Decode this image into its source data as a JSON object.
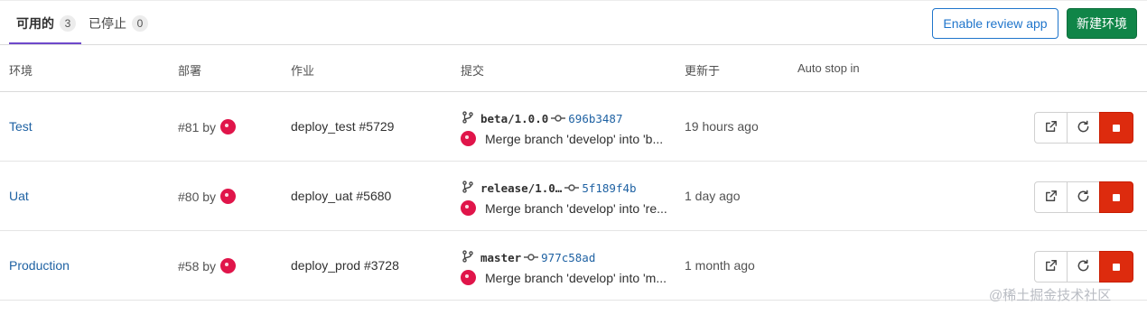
{
  "tabs": [
    {
      "label": "可用的",
      "count": "3"
    },
    {
      "label": "已停止",
      "count": "0"
    }
  ],
  "buttons": {
    "review_app": "Enable review app",
    "new_env": "新建环境"
  },
  "columns": {
    "environment": "环境",
    "deployment": "部署",
    "job": "作业",
    "commit": "提交",
    "updated": "更新于",
    "auto_stop": "Auto stop in"
  },
  "rows": [
    {
      "name": "Test",
      "deploy": "#81 by",
      "job": "deploy_test #5729",
      "ref": "beta/1.0.0",
      "sha": "696b3487",
      "message": "Merge branch 'develop' into 'b...",
      "updated": "19 hours ago"
    },
    {
      "name": "Uat",
      "deploy": "#80 by",
      "job": "deploy_uat #5680",
      "ref": "release/1.0…",
      "sha": "5f189f4b",
      "message": "Merge branch 'develop' into 're...",
      "updated": "1 day ago"
    },
    {
      "name": "Production",
      "deploy": "#58 by",
      "job": "deploy_prod #3728",
      "ref": "master",
      "sha": "977c58ad",
      "message": "Merge branch 'develop' into 'm...",
      "updated": "1 month ago"
    }
  ],
  "watermark": "@稀土掘金技术社区",
  "colors": {
    "primary": "#1f75cb",
    "success": "#108548",
    "danger": "#dd2b0e",
    "tab_active": "#6e49cb",
    "avatar": "#e0154a"
  }
}
